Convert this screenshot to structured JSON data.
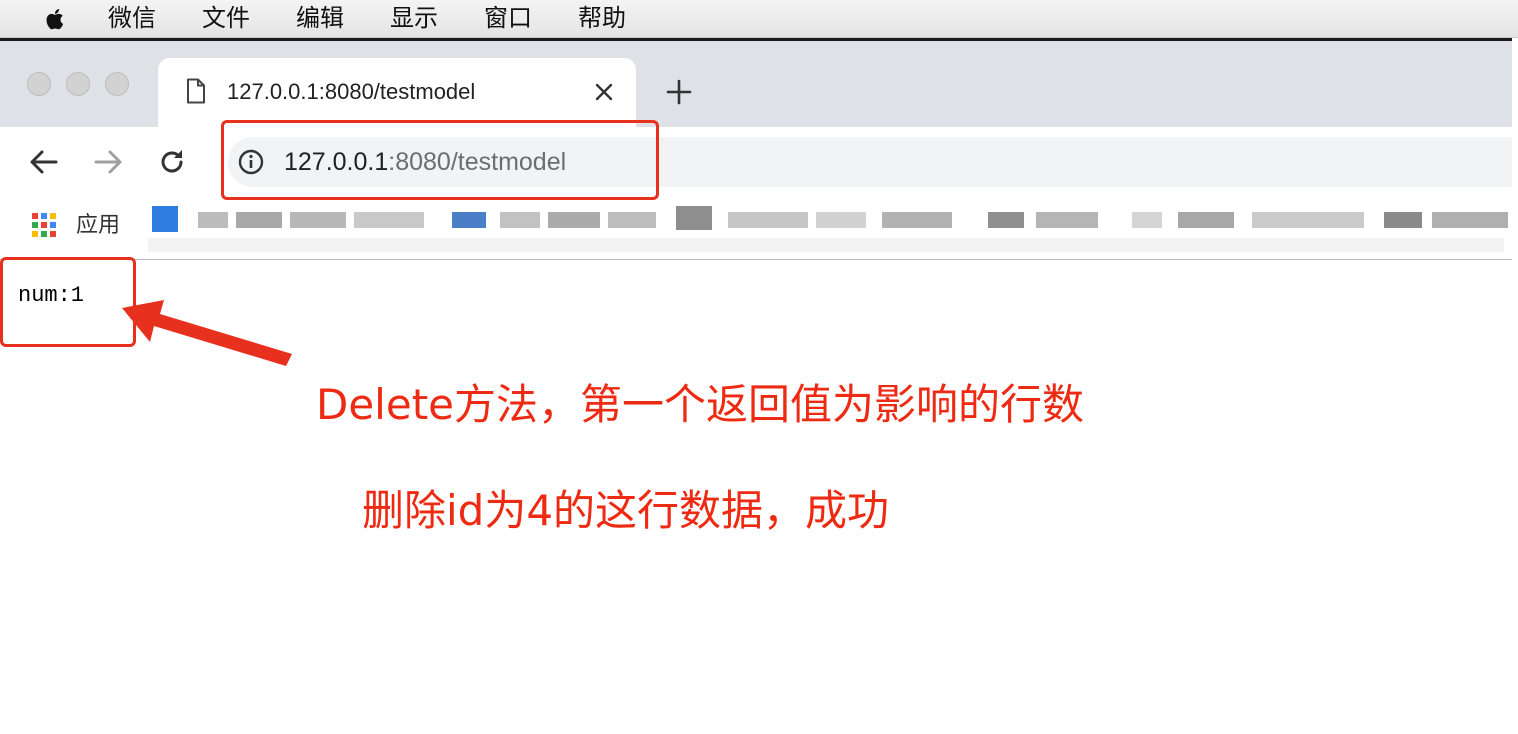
{
  "menubar": {
    "apple_icon": "apple-logo-icon",
    "items": [
      "微信",
      "文件",
      "编辑",
      "显示",
      "窗口",
      "帮助"
    ]
  },
  "window": {
    "traffic_lights": [
      "close-icon",
      "minimize-icon",
      "zoom-icon"
    ]
  },
  "tab": {
    "title": "127.0.0.1:8080/testmodel",
    "page_icon": "document-icon",
    "close_icon": "close-icon"
  },
  "new_tab_icon": "plus-icon",
  "toolbar": {
    "back_icon": "arrow-left-icon",
    "forward_icon": "arrow-right-icon",
    "reload_icon": "reload-icon",
    "info_icon": "info-icon",
    "url_host": "127.0.0.1",
    "url_rest": ":8080/testmodel"
  },
  "bookmarks": {
    "apps_label": "应用",
    "apps_icon": "apps-grid-icon"
  },
  "page": {
    "output": "num:1"
  },
  "annotations": {
    "note_1": "Delete方法，第一个返回值为影响的行数",
    "note_2": "删除id为4的这行数据，成功",
    "color": "#ee2a12"
  }
}
